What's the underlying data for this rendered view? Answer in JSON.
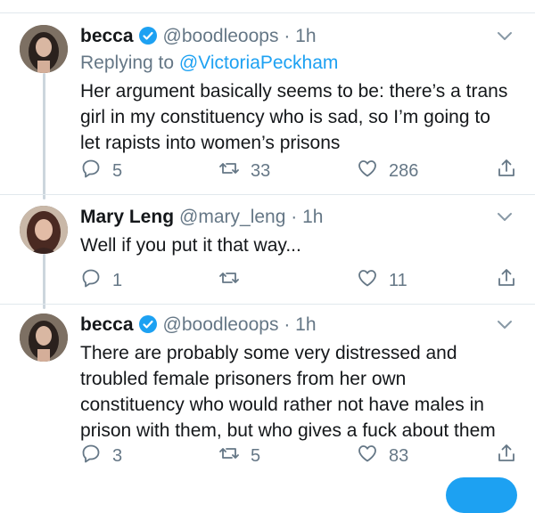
{
  "tweets": [
    {
      "name": "becca",
      "verified": true,
      "handle": "@boodleoops",
      "dot": "·",
      "time": "1h",
      "replying_prefix": "Replying to",
      "replying_to": "@VictoriaPeckham",
      "text": "Her argument basically seems to be: there’s a trans girl in my constituency who is sad, so I’m going to let rapists into women’s prisons",
      "reply_count": "5",
      "retweet_count": "33",
      "like_count": "286"
    },
    {
      "name": "Mary Leng",
      "verified": false,
      "handle": "@mary_leng",
      "dot": "·",
      "time": "1h",
      "text": "Well if you put it that way...",
      "reply_count": "1",
      "retweet_count": "",
      "like_count": "11"
    },
    {
      "name": "becca",
      "verified": true,
      "handle": "@boodleoops",
      "dot": "·",
      "time": "1h",
      "text": "There are probably some very distressed and troubled female prisoners from her own constituency who would rather not have males in prison with them, but who gives a fuck about them",
      "reply_count": "3",
      "retweet_count": "5",
      "like_count": "83"
    }
  ],
  "colors": {
    "text": "#14171a",
    "muted": "#657786",
    "link": "#1da1f2",
    "verified": "#1da1f2",
    "divider": "#e1e8ed",
    "thread_line": "#ccd6dd"
  },
  "icons": [
    "verified-badge-icon",
    "chevron-down-icon",
    "reply-icon",
    "retweet-icon",
    "like-icon",
    "share-icon"
  ]
}
